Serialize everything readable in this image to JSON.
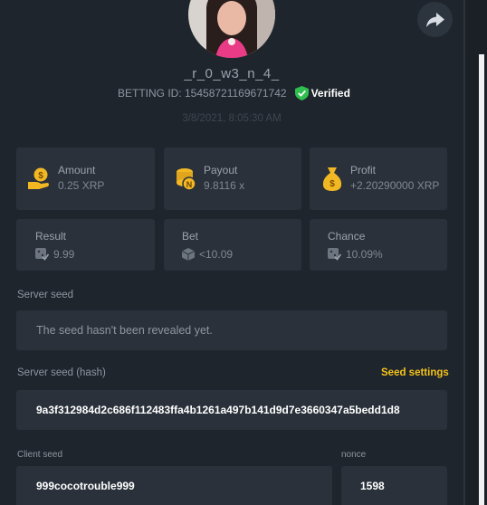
{
  "profile": {
    "username": "_r_0_w3_n_4_",
    "betting_id": "BETTING ID: 15458721169671742",
    "verified_label": "Verified",
    "timestamp": "3/8/2021, 8:05:30 AM"
  },
  "stats": {
    "amount": {
      "label": "Amount",
      "value": "0.25 XRP",
      "icon": "coin-hand-icon"
    },
    "payout": {
      "label": "Payout",
      "value": "9.8116 x",
      "icon": "coin-stack-icon"
    },
    "profit": {
      "label": "Profit",
      "value": "+2.20290000 XRP",
      "icon": "money-bag-icon"
    },
    "result": {
      "label": "Result",
      "value": "9.99",
      "icon": "dice-check-icon"
    },
    "bet": {
      "label": "Bet",
      "value": "<10.09",
      "icon": "cube-icon"
    },
    "chance": {
      "label": "Chance",
      "value": "10.09%",
      "icon": "dice-check-icon"
    }
  },
  "server_seed": {
    "label": "Server seed",
    "value": "The seed hasn't been revealed yet."
  },
  "server_seed_hash": {
    "label": "Server seed (hash)",
    "settings_label": "Seed settings",
    "value": "9a3f312984d2c686f112483ffa4b1261a497b141d9d7e3660347a5bedd1d8"
  },
  "client_seed": {
    "label": "Client seed",
    "value": "999cocotrouble999"
  },
  "nonce": {
    "label": "nonce",
    "value": "1598"
  },
  "colors": {
    "background": "#1f252d",
    "card": "#2a313a",
    "accent_yellow": "#f4c31a",
    "verified_green": "#2fbf4f"
  }
}
